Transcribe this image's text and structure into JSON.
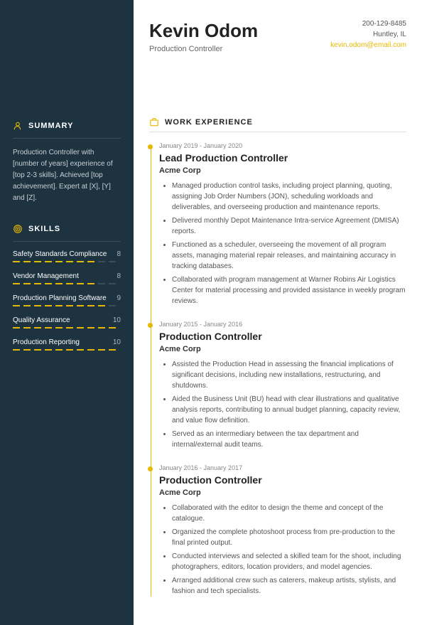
{
  "name": "Kevin Odom",
  "title": "Production Controller",
  "contact": {
    "phone": "200-129-8485",
    "location": "Huntley, IL",
    "email": "kevin.odom@email.com"
  },
  "sidebar": {
    "summary_label": "SUMMARY",
    "summary_text": "Production Controller with [number of years] experience of [top 2-3 skills]. Achieved [top achievement]. Expert at [X], [Y] and [Z].",
    "skills_label": "SKILLS",
    "skills": [
      {
        "name": "Safety Standards Compliance",
        "rating": "8"
      },
      {
        "name": "Vendor Management",
        "rating": "8"
      },
      {
        "name": "Production Planning Software",
        "rating": "9"
      },
      {
        "name": "Quality Assurance",
        "rating": "10"
      },
      {
        "name": "Production Reporting",
        "rating": "10"
      }
    ]
  },
  "experience_label": "WORK EXPERIENCE",
  "jobs": [
    {
      "dates": "January 2019 - January 2020",
      "title": "Lead Production Controller",
      "company": "Acme Corp",
      "bullets": [
        "Managed production control tasks, including project planning, quoting, assigning Job Order Numbers (JON), scheduling workloads and deliverables, and overseeing production and maintenance reports.",
        "Delivered monthly Depot Maintenance Intra-service Agreement (DMISA) reports.",
        "Functioned as a scheduler, overseeing the movement of all program assets, managing material repair releases, and maintaining accuracy in tracking databases.",
        "Collaborated with program management at Warner Robins Air Logistics Center for material processing and provided assistance in weekly program reviews."
      ]
    },
    {
      "dates": "January 2015 - January 2016",
      "title": "Production Controller",
      "company": "Acme Corp",
      "bullets": [
        "Assisted the Production Head in assessing the financial implications of significant decisions, including new installations, restructuring, and shutdowns.",
        "Aided the Business Unit (BU) head with clear illustrations and qualitative analysis reports, contributing to annual budget planning, capacity review, and value flow definition.",
        "Served as an intermediary between the tax department and internal/external audit teams."
      ]
    },
    {
      "dates": "January 2016 - January 2017",
      "title": "Production Controller",
      "company": "Acme Corp",
      "bullets": [
        "Collaborated with the editor to design the theme and concept of the catalogue.",
        "Organized the complete photoshoot process from pre-production to the final printed output.",
        "Conducted interviews and selected a skilled team for the shoot, including photographers, editors, location providers, and model agencies.",
        "Arranged additional crew such as caterers, makeup artists, stylists, and fashion and tech specialists."
      ]
    }
  ],
  "colors": {
    "accent": "#e6b800",
    "sidebar_bg": "#1d3340"
  }
}
